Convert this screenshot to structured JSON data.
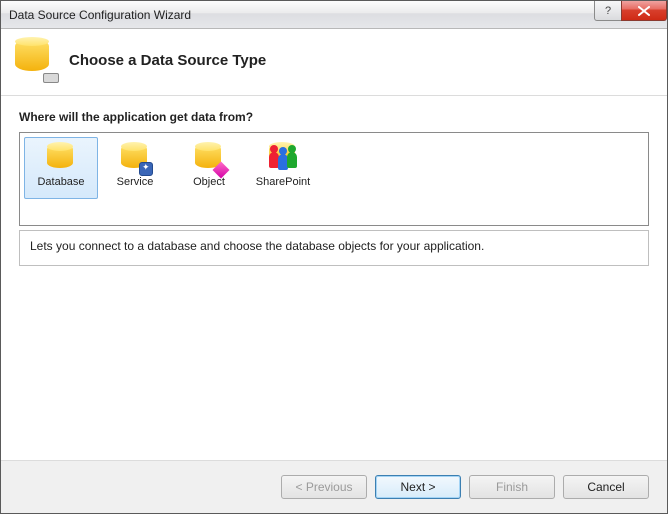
{
  "window": {
    "title": "Data Source Configuration Wizard"
  },
  "header": {
    "title": "Choose a Data Source Type"
  },
  "main": {
    "prompt": "Where will the application get data from?",
    "options": [
      {
        "label": "Database",
        "selected": true
      },
      {
        "label": "Service",
        "selected": false
      },
      {
        "label": "Object",
        "selected": false
      },
      {
        "label": "SharePoint",
        "selected": false
      }
    ],
    "description": "Lets you connect to a database and choose the database objects for your application."
  },
  "footer": {
    "previous": "< Previous",
    "next": "Next >",
    "finish": "Finish",
    "cancel": "Cancel"
  }
}
